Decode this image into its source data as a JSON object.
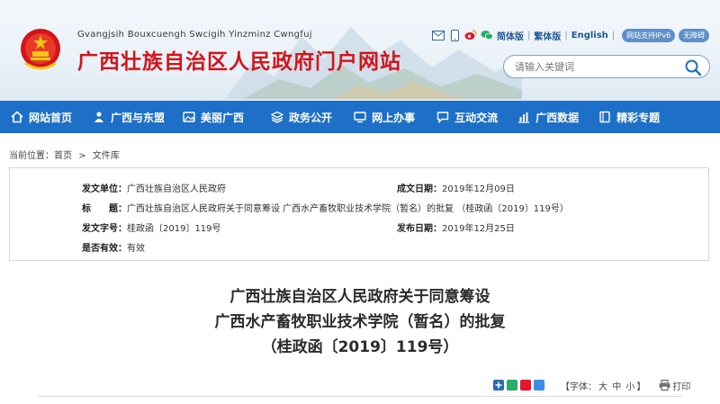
{
  "header": {
    "roman_name": "Gvangjsih Bouxcuengh Swcigih Yinzminz Cwngfuj",
    "site_title": "广西壮族自治区人民政府门户网站",
    "lang_links": [
      "简体版",
      "繁体版",
      "English"
    ],
    "ipv6_badge": "网站支持IPv6",
    "accessibility_badge": "无障碍",
    "search_placeholder": "请输入关键词",
    "icons": [
      "mail-icon",
      "mobile-icon",
      "weibo-icon",
      "wechat-icon"
    ],
    "title_color": "#d2151b"
  },
  "nav": {
    "items": [
      {
        "label": "网站首页",
        "icon": "home-icon"
      },
      {
        "label": "广西与东盟",
        "icon": "people-icon"
      },
      {
        "label": "美丽广西",
        "icon": "photo-icon"
      },
      {
        "label": "政务公开",
        "icon": "layers-icon"
      },
      {
        "label": "网上办事",
        "icon": "monitor-icon"
      },
      {
        "label": "互动交流",
        "icon": "chat-icon"
      },
      {
        "label": "广西数据",
        "icon": "bar-chart-icon"
      },
      {
        "label": "精彩专题",
        "icon": "book-icon"
      }
    ],
    "color": "#1d6fc7"
  },
  "breadcrumb": {
    "prefix": "当前位置：",
    "home": "首页",
    "sep": ">",
    "current": "文件库"
  },
  "doc_info": {
    "issuer_label": "发文单位：",
    "issuer": "广西壮族自治区人民政府",
    "date_label": "成文日期：",
    "date": "2019年12月09日",
    "title_label": "标　　题：",
    "title": "广西壮族自治区人民政府关于同意筹设 广西水产畜牧职业技术学院（暂名）的批复 （桂政函〔2019〕119号）",
    "number_label": "发文字号：",
    "number": "桂政函〔2019〕119号",
    "pub_label": "发布日期：",
    "pub_date": "2019年12月25日",
    "valid_label": "是否有效：",
    "valid": "有效"
  },
  "document": {
    "title_lines": [
      "广西壮族自治区人民政府关于同意筹设",
      "广西水产畜牧职业技术学院（暂名）的批复",
      "（桂政函〔2019〕119号）"
    ]
  },
  "tools": {
    "font_label": "【字体：",
    "sizes": [
      "大",
      "中",
      "小"
    ],
    "font_close": "】",
    "print_label": "打印",
    "share_icons": [
      "share-plus-icon",
      "share-wechat-icon",
      "share-weibo-icon",
      "share-qq-icon"
    ]
  }
}
